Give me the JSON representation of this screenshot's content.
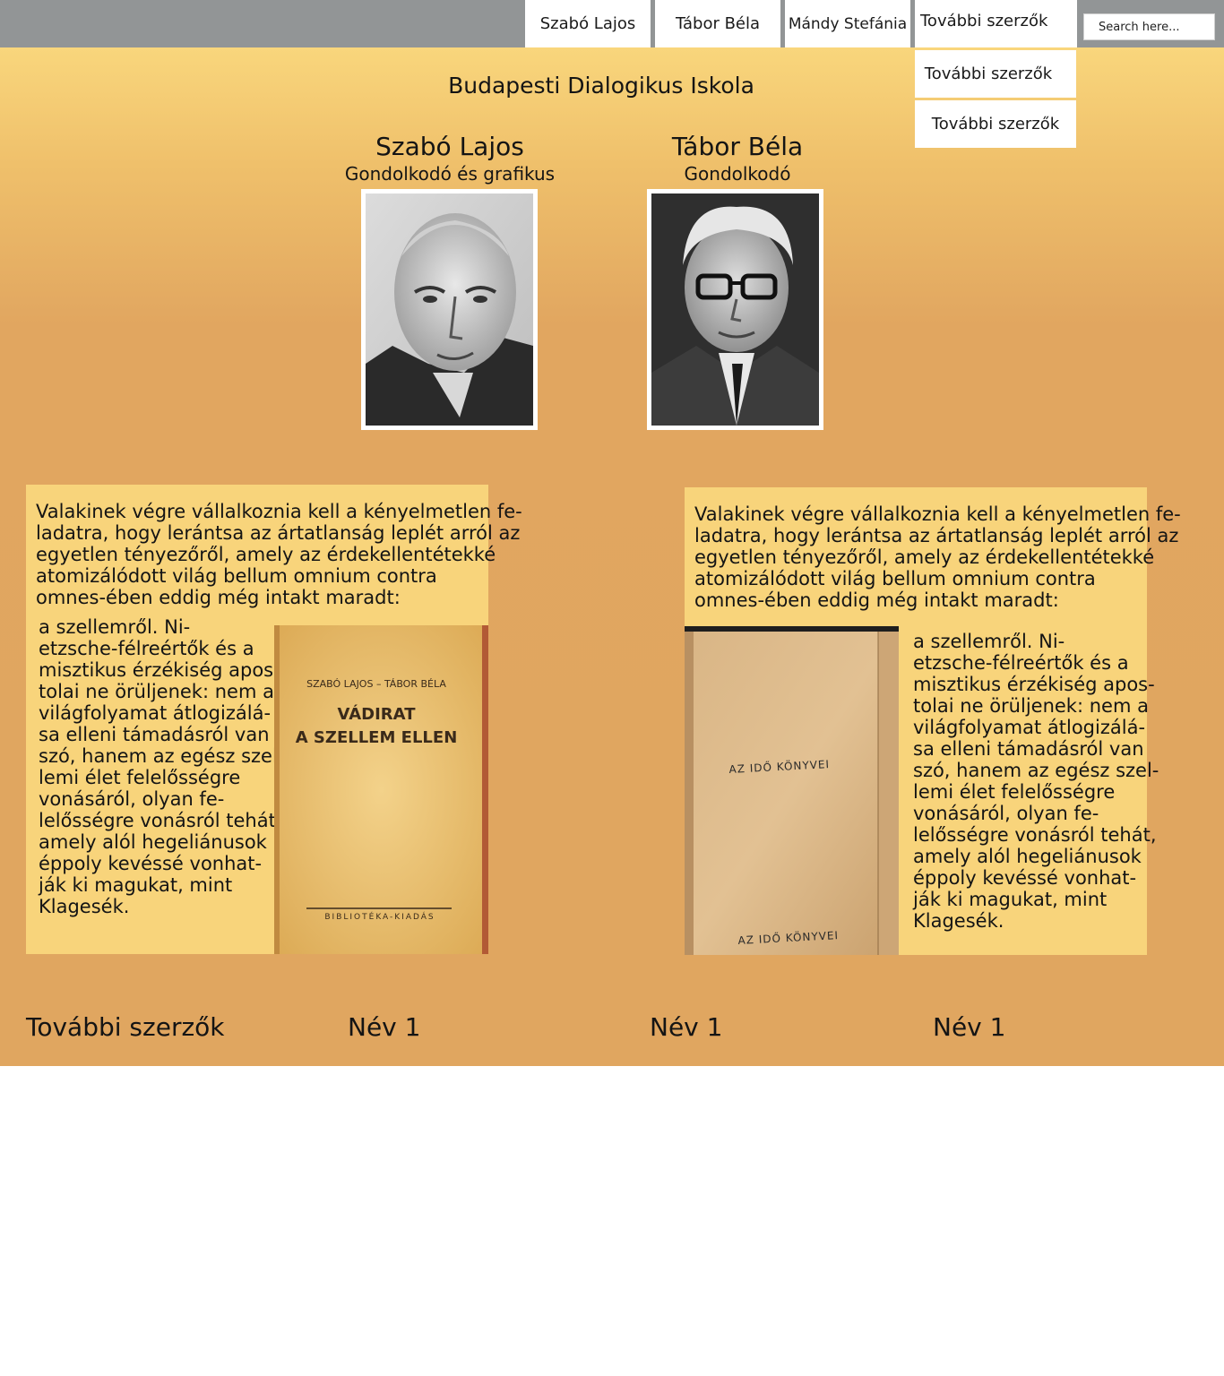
{
  "nav": {
    "items": [
      {
        "label": "Szabó Lajos"
      },
      {
        "label": "Tábor Béla"
      },
      {
        "label": "Mándy Stefánia"
      },
      {
        "label": "További szerzők"
      }
    ],
    "search_placeholder": "Search here...",
    "dropdown": [
      {
        "label": "További szerzők"
      },
      {
        "label": "További szerzők"
      }
    ]
  },
  "page": {
    "title": "Budapesti Dialogikus Iskola"
  },
  "authors": [
    {
      "name": "Szabó Lajos",
      "role": "Gondolkodó és grafikus",
      "portrait": "portrait-photo"
    },
    {
      "name": "Tábor Béla",
      "role": "Gondolkodó",
      "portrait": "portrait-photo"
    }
  ],
  "cards": [
    {
      "intro": "Valakinek végre vállalkoznia kell a kényelmetlen fe-\nladatra, hogy lerántsa az ártatlanság leplét arról az\negyetlen tényezőről, amely az érdekellentétekké\natomizálódott világ bellum omnium contra\nomnes-ében eddig még intakt maradt:",
      "body": "a szellemről. Ni-\netzsche-félreértők és a\nmisztikus érzékiség apos-\ntolai ne örüljenek: nem a\nvilágfolyamat átlogizálá-\nsa elleni támadásról van\nszó, hanem az egész szel-\nlemi élet felelősségre\nvonásáról, olyan fe-\nlelősségre vonásról tehát,\namely alól hegeliánusok\néppoly kevéssé vonhat-\nják ki magukat, mint\nKlagesék.",
      "cover": {
        "authors": "SZABÓ LAJOS – TÁBOR BÉLA",
        "title_line1": "VÁDIRAT",
        "title_line2": "A SZELLEM ELLEN",
        "publisher": "BIBLIOTÉKA-KIADÁS"
      }
    },
    {
      "intro": "Valakinek végre vállalkoznia kell a kényelmetlen fe-\nladatra, hogy lerántsa az ártatlanság leplét arról az\negyetlen tényezőről, amely az érdekellentétekké\natomizálódott világ bellum omnium contra\nomnes-ében eddig még intakt maradt:",
      "body": "a szellemről. Ni-\netzsche-félreértők és a\nmisztikus érzékiség apos-\ntolai ne örüljenek: nem a\nvilágfolyamat átlogizálá-\nsa elleni támadásról van\nszó, hanem az egész szel-\nlemi élet felelősségre\nvonásáról, olyan fe-\nlelősségre vonásról tehát,\namely alól hegeliánusok\néppoly kevéssé vonhat-\nják ki magukat, mint\nKlagesék.",
      "cover": {
        "top_text": "AZ IDŐ KÖNYVEI",
        "bottom_text": "AZ IDŐ KÖNYVEI"
      }
    }
  ],
  "footer": {
    "label": "További szerzők",
    "names": [
      "Név 1",
      "Név 1",
      "Név 1"
    ]
  },
  "colors": {
    "topbar": "#929596",
    "background_top": "#f9d67c",
    "background": "#e0a660",
    "card": "#f8d47b"
  }
}
